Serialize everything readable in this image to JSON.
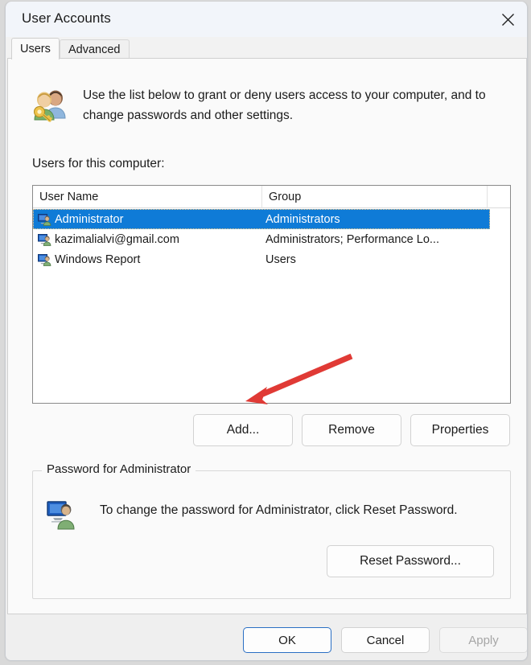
{
  "window": {
    "title": "User Accounts",
    "close_icon": "close-icon"
  },
  "tabs": [
    {
      "label": "Users",
      "active": true
    },
    {
      "label": "Advanced",
      "active": false
    }
  ],
  "page": {
    "description": "Use the list below to grant or deny users access to your computer, and to change passwords and other settings.",
    "list_label": "Users for this computer:",
    "header_icon": "users-key-icon"
  },
  "list": {
    "columns": [
      "User Name",
      "Group",
      ""
    ],
    "rows": [
      {
        "icon": "user-account-icon",
        "name": "Administrator",
        "group": "Administrators",
        "selected": true
      },
      {
        "icon": "user-account-icon",
        "name": "kazimalialvi@gmail.com",
        "group": "Administrators; Performance Lo...",
        "selected": false
      },
      {
        "icon": "user-account-icon",
        "name": "Windows Report",
        "group": "Users",
        "selected": false
      }
    ]
  },
  "actions": {
    "add": "Add...",
    "remove": "Remove",
    "properties": "Properties"
  },
  "password_group": {
    "title": "Password for Administrator",
    "icon": "user-account-icon",
    "text": "To change the password for Administrator, click Reset Password.",
    "reset_button": "Reset Password..."
  },
  "dialog_buttons": {
    "ok": "OK",
    "cancel": "Cancel",
    "apply": "Apply"
  },
  "annotation": {
    "arrow_color": "#e03a35",
    "arrow_target": "Add..."
  },
  "colors": {
    "selection": "#0f7bd7",
    "titlebar": "#f2f5fa",
    "page": "#fafafa",
    "bottombar": "#efefef",
    "accent_focus": "#2a6fc4"
  }
}
